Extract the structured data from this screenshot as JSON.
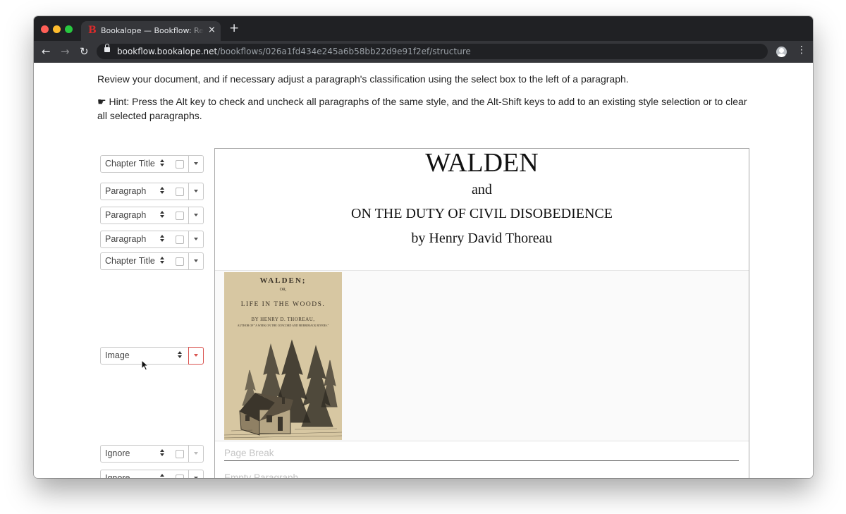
{
  "browser": {
    "tab_favicon": "B",
    "tab_title": "Bookalope — Bookflow: Review",
    "tab_close": "×",
    "new_tab": "+",
    "url_host": "bookflow.bookalope.net",
    "url_path": "/bookflows/026a1fd434e245a6b58bb22d9e91f2ef/structure",
    "icons": [
      "back-arrow-icon",
      "forward-arrow-icon",
      "reload-icon",
      "lock-icon",
      "star-icon",
      "profile-icon",
      "menu-dots-icon"
    ],
    "glyphs": {
      "back": "←",
      "forward": "→",
      "reload": "↻",
      "star": "☆",
      "menu": "⋮"
    }
  },
  "page": {
    "instructions": "Review your document, and if necessary adjust a paragraph's classification using the select box to the left of a paragraph.",
    "hint_icon": "☛",
    "hint": "Hint: Press the Alt key to check and uncheck all paragraphs of the same style, and the Alt-Shift keys to add to an existing style selection or to clear all selected paragraphs."
  },
  "paragraph_controls": [
    {
      "style": "Chapter Title"
    },
    {
      "style": "Paragraph"
    },
    {
      "style": "Paragraph"
    },
    {
      "style": "Paragraph"
    },
    {
      "style": "Chapter Title"
    },
    {
      "style": "Image"
    },
    {
      "style": "Ignore"
    },
    {
      "style": "Ignore"
    }
  ],
  "document": {
    "title": "WALDEN",
    "and": "and",
    "subtitle": "ON THE DUTY OF CIVIL DISOBEDIENCE",
    "author": "by Henry David Thoreau",
    "cover_image": {
      "title": "WALDEN;",
      "or": "OR,",
      "subtitle": "LIFE IN THE WOODS.",
      "author": "BY HENRY D. THOREAU,",
      "author_note": "AUTHOR OF \"A WEEK ON THE CONCORD AND MERRIMACK RIVERS.\""
    },
    "page_break": "Page Break",
    "empty_paragraph": "Empty Paragraph"
  },
  "colors": {
    "accent_red": "#d9534f",
    "chrome_dark": "#202124",
    "chrome_toolbar": "#35363a",
    "cover_paper": "#d7c7a2"
  }
}
